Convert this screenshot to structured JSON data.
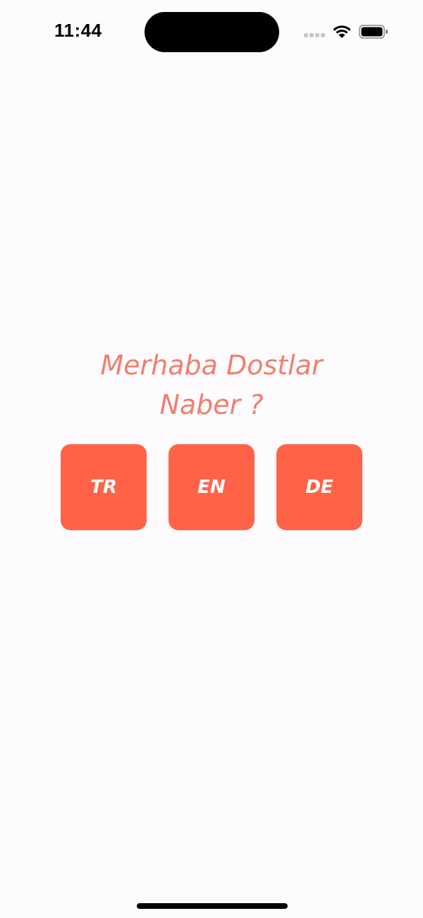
{
  "status_bar": {
    "time": "11:44"
  },
  "main": {
    "greeting_line1": "Merhaba Dostlar",
    "greeting_line2": "Naber ?",
    "languages": [
      {
        "label": "TR"
      },
      {
        "label": "EN"
      },
      {
        "label": "DE"
      }
    ]
  },
  "colors": {
    "background": "#FDFBFD",
    "greeting_text": "#F07F6E",
    "button_bg": "#FF6347",
    "button_text": "#FFFFFF"
  },
  "icons": [
    "signal-icon",
    "wifi-icon",
    "battery-icon"
  ]
}
